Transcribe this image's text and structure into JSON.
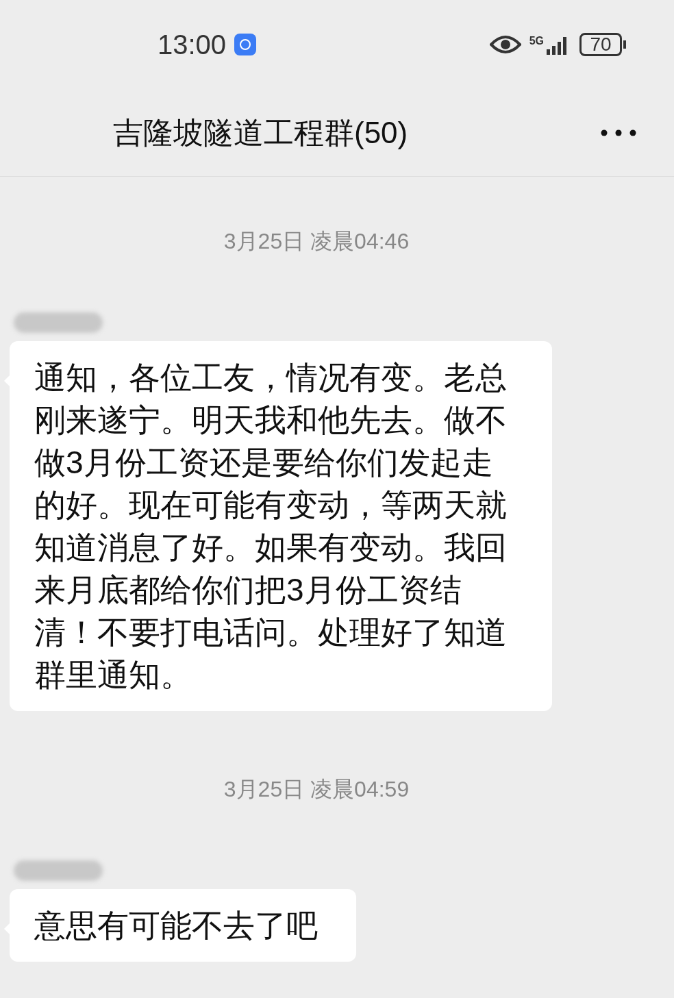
{
  "status_bar": {
    "time": "13:00",
    "network": "5G",
    "battery": "70"
  },
  "header": {
    "title": "吉隆坡隧道工程群(50)"
  },
  "messages": [
    {
      "timestamp": "3月25日 凌晨04:46",
      "text": "通知，各位工友，情况有变。老总刚来遂宁。明天我和他先去。做不做3月份工资还是要给你们发起走的好。现在可能有变动，等两天就知道消息了好。如果有变动。我回来月底都给你们把3月份工资结清！不要打电话问。处理好了知道群里通知。"
    },
    {
      "timestamp": "3月25日 凌晨04:59",
      "text": "意思有可能不去了吧"
    }
  ]
}
